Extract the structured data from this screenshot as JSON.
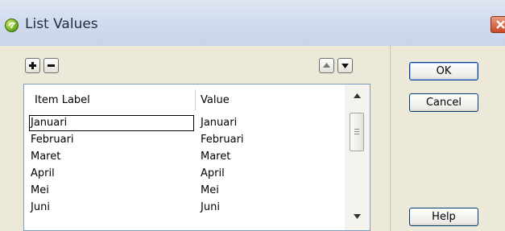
{
  "window": {
    "title": "List Values",
    "icon": "app-icon",
    "close_icon": "close-icon"
  },
  "toolbar": {
    "add_icon": "plus-icon",
    "remove_icon": "minus-icon",
    "move_up_icon": "triangle-up-icon",
    "move_down_icon": "triangle-down-icon"
  },
  "list": {
    "columns": [
      "Item Label",
      "Value"
    ],
    "rows": [
      {
        "label": "Januari",
        "value": "Januari"
      },
      {
        "label": "Februari",
        "value": "Februari"
      },
      {
        "label": "Maret",
        "value": "Maret"
      },
      {
        "label": "April",
        "value": "April"
      },
      {
        "label": "Mei",
        "value": "Mei"
      },
      {
        "label": "Juni",
        "value": "Juni"
      }
    ]
  },
  "buttons": {
    "ok": "OK",
    "cancel": "Cancel",
    "help": "Help"
  }
}
